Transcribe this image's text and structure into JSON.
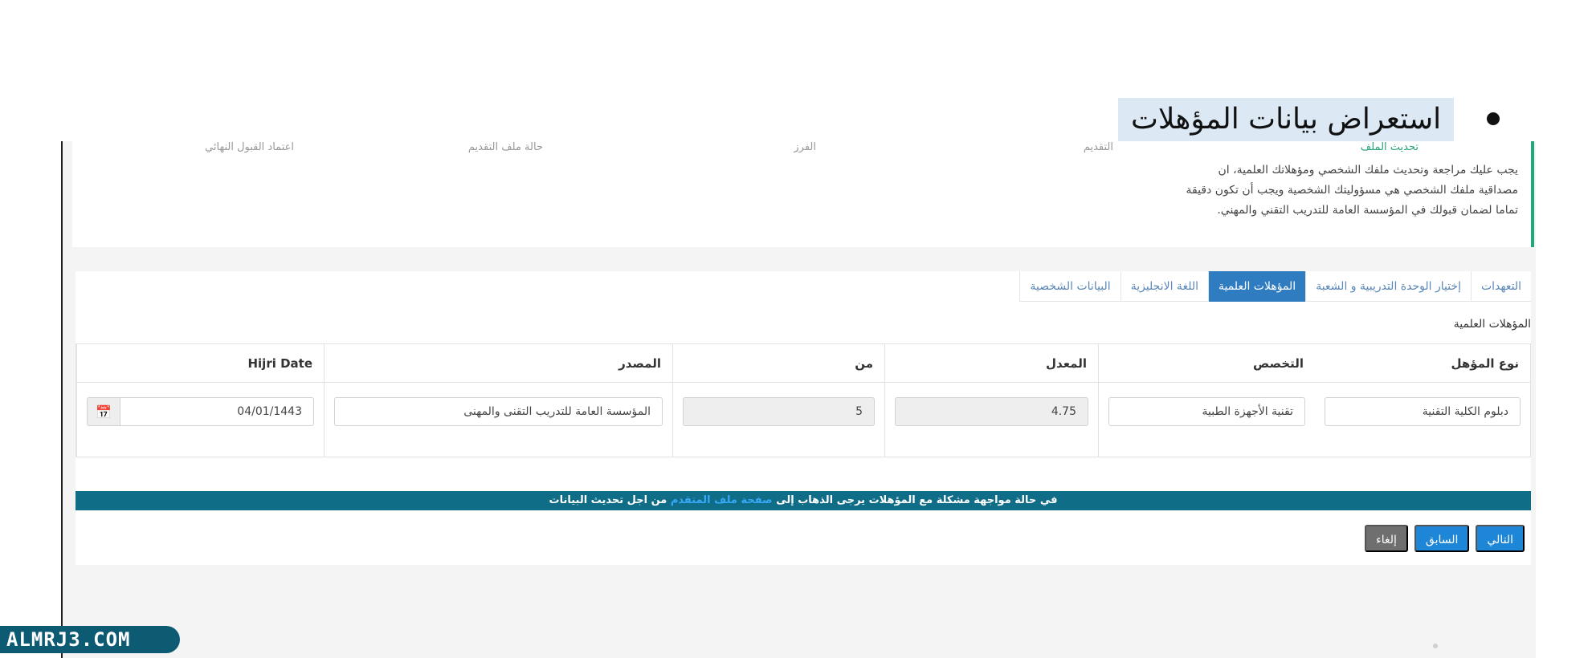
{
  "heading": {
    "text": "استعراض بيانات المؤهلات"
  },
  "status_row": [
    "تحديث الملف",
    "التقديم",
    "الفرز",
    "حالة ملف التقديم",
    "اعتماد القبول النهائي"
  ],
  "notice": {
    "text": "يجب عليك مراجعة وتحديث ملفك الشخصي ومؤهلاتك العلمية، ان مصداقية ملفك الشخصي هي مسؤوليتك الشخصية ويجب أن تكون دقيقة تماما لضمان قبولك في المؤسسة العامة للتدريب التقني والمهني."
  },
  "tabs": [
    {
      "label": "البيانات الشخصية",
      "active": false
    },
    {
      "label": "اللغة الانجليزية",
      "active": false
    },
    {
      "label": "المؤهلات العلمية",
      "active": true
    },
    {
      "label": "إختيار الوحدة التدريبية و الشعبة",
      "active": false
    },
    {
      "label": "التعهدات",
      "active": false
    }
  ],
  "section_title": "المؤهلات العلمية",
  "table": {
    "headers": {
      "qualification_type": "نوع المؤهل",
      "major": "التخصص",
      "gpa": "المعدل",
      "out_of": "من",
      "source": "المصدر",
      "hijri_date": "Hijri Date"
    },
    "row": {
      "qualification_type": "دبلوم الكلية التقنية",
      "major": "تقنية الأجهزة الطبية",
      "gpa": "4.75",
      "out_of": "5",
      "source": "المؤسسة العامة للتدريب التقنى والمهنى",
      "hijri_date": "04/01/1443"
    }
  },
  "alert": {
    "before": "في حالة مواجهة مشكلة مع المؤهلات يرجى الذهاب إلى",
    "link": "صفحة ملف المتقدم",
    "after": "من اجل تحديث البيانات"
  },
  "actions": {
    "cancel": "إلغاء",
    "previous": "السابق",
    "next": "التالي"
  },
  "logo": {
    "text": "ALMRJ3.COM"
  },
  "icons": {
    "calendar": "calendar-icon"
  },
  "colors": {
    "accent_blue": "#2f7cc1",
    "button_blue": "#1e86d6",
    "alert_teal": "#0f6d88",
    "notice_green": "#23a57d",
    "cancel_grey": "#6f6f6f"
  }
}
